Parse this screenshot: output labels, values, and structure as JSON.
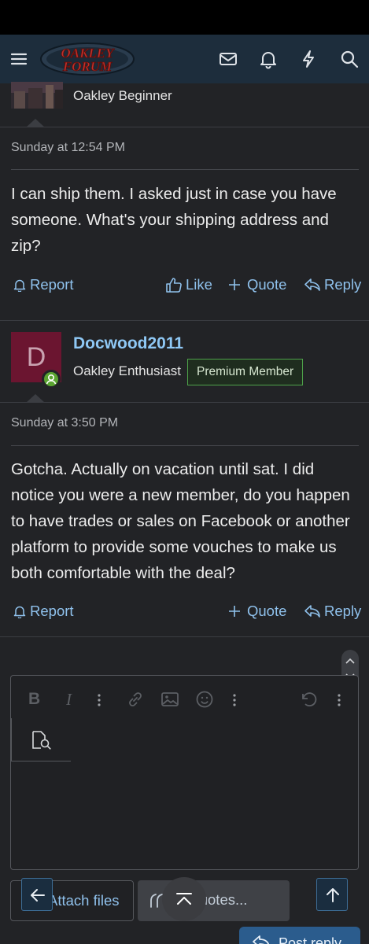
{
  "header": {
    "logo_line1": "OAKLEY",
    "logo_line2": "FORUM",
    "icons": [
      "menu-icon",
      "inbox-icon",
      "bell-icon",
      "whats-new-icon",
      "search-icon"
    ]
  },
  "post1": {
    "user_title": "Oakley Beginner",
    "timestamp": "Sunday at 12:54 PM",
    "message": "I can ship them. I asked just in case you have someone. What's your shipping address and zip?",
    "actions": {
      "report": "Report",
      "like": "Like",
      "quote": "Quote",
      "reply": "Reply"
    }
  },
  "post2": {
    "avatar_letter": "D",
    "username": "Docwood2011",
    "user_title": "Oakley Enthusiast",
    "badge": "Premium Member",
    "timestamp": "Sunday at 3:50 PM",
    "message": "Gotcha. Actually on vacation until sat. I did notice you were a new member, do you happen to have trades or sales on Facebook or another platform to provide some vouches to make us both comfortable with the deal?",
    "actions": {
      "report": "Report",
      "quote": "Quote",
      "reply": "Reply"
    }
  },
  "editor": {
    "toolbar_icons": [
      "bold-icon",
      "italic-icon",
      "more-options-icon",
      "link-icon",
      "image-icon",
      "smilie-icon",
      "more-options-icon",
      "undo-icon",
      "more-options-icon"
    ],
    "bold_glyph": "B",
    "italic_glyph": "I"
  },
  "buttons": {
    "attach_files": "Attach files",
    "insert_quotes": "rt quotes...",
    "post_reply": "Post reply"
  },
  "colors": {
    "nav_bg": "#1d2d3c",
    "page_bg": "#222326",
    "link": "#8fc1ec",
    "username": "#8fc8f5",
    "badge_border": "#4ea24a",
    "avatar_bg": "#6b1530",
    "primary_button": "#2b5c8d"
  }
}
